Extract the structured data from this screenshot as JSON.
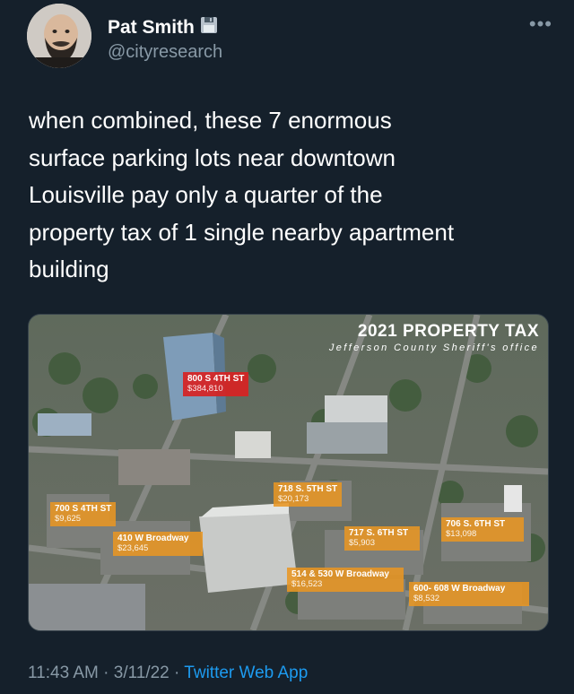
{
  "author": {
    "name": "Pat Smith",
    "handle": "@cityresearch"
  },
  "tweet": {
    "text": "when combined, these 7 enormous\nsurface parking lots near downtown\nLouisville pay only a quarter of the\nproperty tax of 1 single nearby apartment\nbuilding"
  },
  "image": {
    "title": "2021 PROPERTY TAX",
    "subtitle": "Jefferson County Sheriff's office",
    "labels": [
      {
        "address": "800 S 4TH ST",
        "tax": "$384,810",
        "style": "red"
      },
      {
        "address": "718 S. 5TH ST",
        "tax": "$20,173",
        "style": "orange"
      },
      {
        "address": "700 S 4TH ST",
        "tax": "$9,625",
        "style": "orange"
      },
      {
        "address": "410 W Broadway",
        "tax": "$23,645",
        "style": "orange"
      },
      {
        "address": "717 S. 6TH ST",
        "tax": "$5,903",
        "style": "orange"
      },
      {
        "address": "706 S. 6TH ST",
        "tax": "$13,098",
        "style": "orange"
      },
      {
        "address": "514 & 530 W Broadway",
        "tax": "$16,523",
        "style": "orange"
      },
      {
        "address": "600- 608 W Broadway",
        "tax": "$8,532",
        "style": "orange"
      }
    ]
  },
  "footer": {
    "time": "11:43 AM",
    "separator": " · ",
    "date": "3/11/22",
    "app": "Twitter Web App"
  },
  "icons": {
    "more": "more-dots-icon",
    "badge": "floppy-disk-icon",
    "avatar": "profile-avatar"
  },
  "colors": {
    "background": "#15202b",
    "muted": "#8899a6",
    "link": "#1d9bf0",
    "label_orange": "#e89623",
    "label_red": "#d72323"
  }
}
